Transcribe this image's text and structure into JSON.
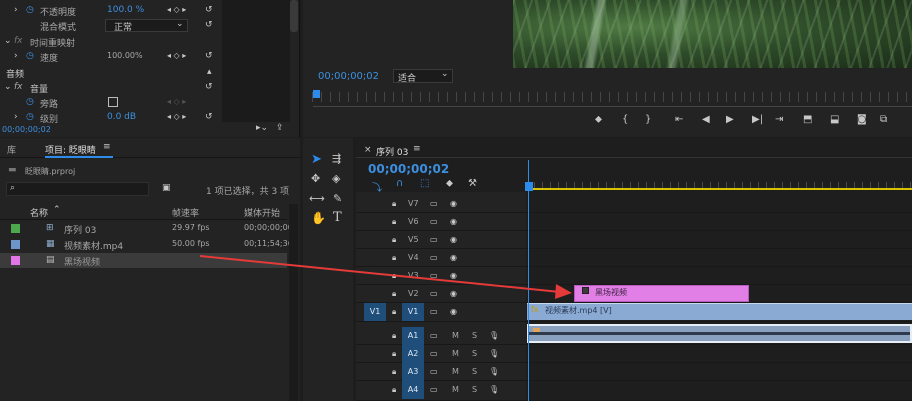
{
  "effect_controls": {
    "opacity_label": "不透明度",
    "opacity_value": "100.0 %",
    "blend_label": "混合模式",
    "blend_value": "正常",
    "time_remap_label": "时间重映射",
    "speed_label": "速度",
    "speed_value": "100.00%",
    "audio_section": "音频",
    "volume_label": "音量",
    "bypass_label": "旁路",
    "level_label": "级别",
    "level_value": "0.0 dB",
    "timecode": "00;00;00;02"
  },
  "program": {
    "timecode": "00;00;00;02",
    "fit_value": "适合"
  },
  "project": {
    "tab_lib": "库",
    "tab_project": "项目: 眨眼睛",
    "filename": "眨眼睛.prproj",
    "search_placeholder": "",
    "selection_status": "1 项已选择，共 3 项",
    "col_name": "名称",
    "col_fps": "帧速率",
    "col_start": "媒体开始",
    "items": [
      {
        "name": "序列 03",
        "fps": "29.97 fps",
        "start": "00;00;00;00",
        "color": "#4caa4c"
      },
      {
        "name": "视频素材.mp4",
        "fps": "50.00 fps",
        "start": "00;11;54;36",
        "color": "#6e95c9"
      },
      {
        "name": "黑场视频",
        "fps": "",
        "start": "",
        "color": "#e276e6"
      }
    ]
  },
  "timeline": {
    "tab_name": "序列 03",
    "timecode": "00;00;00;02",
    "tracks": [
      {
        "label": "V7",
        "type": "video"
      },
      {
        "label": "V6",
        "type": "video"
      },
      {
        "label": "V5",
        "type": "video"
      },
      {
        "label": "V4",
        "type": "video"
      },
      {
        "label": "V3",
        "type": "video"
      },
      {
        "label": "V2",
        "type": "video"
      },
      {
        "label": "V1",
        "type": "video",
        "source": "V1"
      },
      {
        "label": "A1",
        "type": "audio"
      },
      {
        "label": "A2",
        "type": "audio"
      },
      {
        "label": "A3",
        "type": "audio"
      },
      {
        "label": "A4",
        "type": "audio"
      }
    ],
    "clip_black_label": "黑场视频",
    "clip_video_label": "视频素材.mp4 [V]",
    "audio_mute": "M",
    "audio_solo": "S"
  },
  "colors": {
    "accent_blue": "#2d8ceb",
    "work_area": "#d8c200",
    "arrow": "#e53a3a",
    "clip_pink": "#e17fe6",
    "clip_blue": "#8aa9d3"
  }
}
